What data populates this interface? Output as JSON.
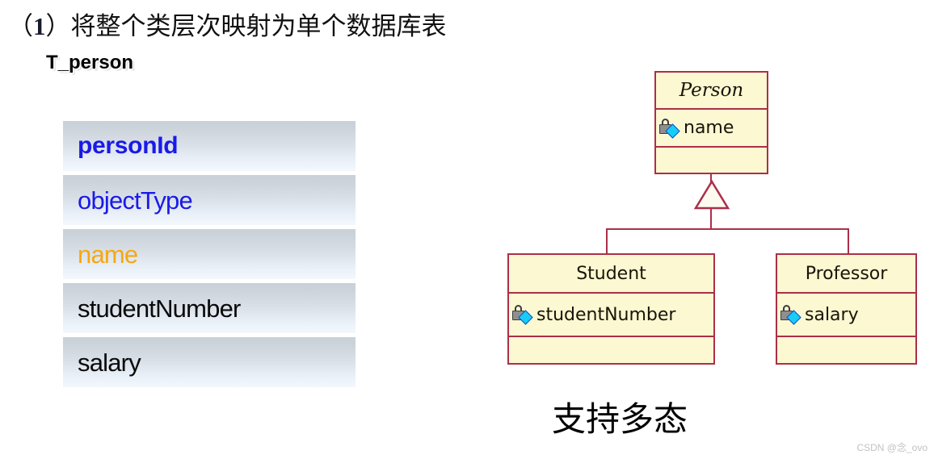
{
  "slide": {
    "heading_prefix": "（",
    "heading_number": "1",
    "heading_suffix": "）将整个类层次映射为单个数据库表",
    "subheading": "T_person",
    "caption": "支持多态",
    "watermark": "CSDN @念_ovo"
  },
  "table": {
    "name": "T_person",
    "rows": [
      {
        "label": "personId",
        "style": "k-bold-blue",
        "role": "primary-key"
      },
      {
        "label": "objectType",
        "style": "k-blue",
        "role": "discriminator"
      },
      {
        "label": "name",
        "style": "k-orange",
        "role": "superclass-attribute"
      },
      {
        "label": "studentNumber",
        "style": "k-black",
        "role": "subclass-attribute"
      },
      {
        "label": "salary",
        "style": "k-black",
        "role": "subclass-attribute"
      }
    ]
  },
  "uml": {
    "classes": [
      {
        "name": "Person",
        "abstract": true,
        "attributes": [
          {
            "name": "name",
            "visibility": "private",
            "icon": "private-attribute-icon"
          }
        ],
        "operations": []
      },
      {
        "name": "Student",
        "abstract": false,
        "attributes": [
          {
            "name": "studentNumber",
            "visibility": "private",
            "icon": "private-attribute-icon"
          }
        ],
        "operations": []
      },
      {
        "name": "Professor",
        "abstract": false,
        "attributes": [
          {
            "name": "salary",
            "visibility": "private",
            "icon": "private-attribute-icon"
          }
        ],
        "operations": []
      }
    ],
    "relations": [
      {
        "type": "generalization",
        "from": "Student",
        "to": "Person"
      },
      {
        "type": "generalization",
        "from": "Professor",
        "to": "Person"
      }
    ]
  },
  "colors": {
    "class_fill": "#fbf8d2",
    "class_border": "#ab2f48",
    "key_blue": "#1a1ae8",
    "attribute_orange": "#f5a812",
    "row_gradient_top": "#c9d0d8",
    "row_gradient_bottom": "#f3f8fd",
    "icon_diamond": "#17cdf5"
  }
}
